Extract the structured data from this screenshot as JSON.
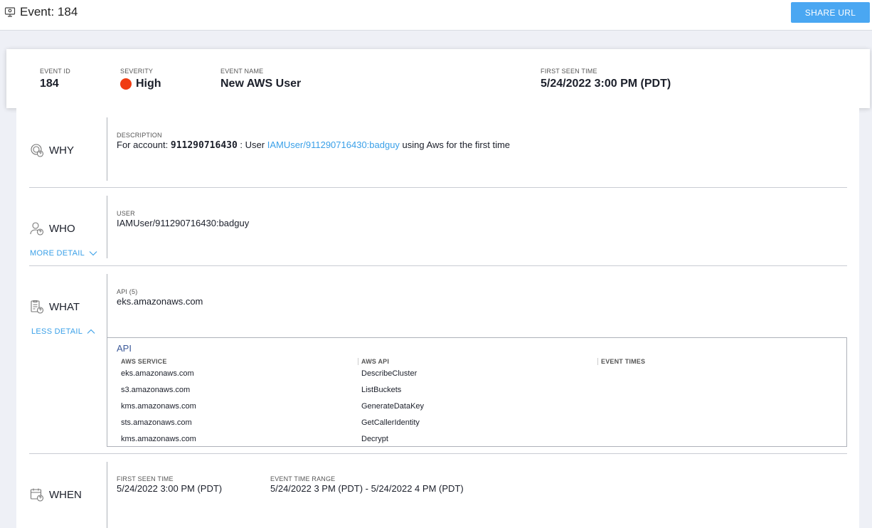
{
  "header": {
    "title": "Event: 184",
    "share_label": "SHARE URL"
  },
  "summary": {
    "event_id_label": "EVENT ID",
    "event_id": "184",
    "severity_label": "SEVERITY",
    "severity": "High",
    "severity_color": "#f03c12",
    "event_name_label": "EVENT NAME",
    "event_name": "New AWS User",
    "first_seen_label": "FIRST SEEN TIME",
    "first_seen": "5/24/2022 3:00 PM (PDT)"
  },
  "why": {
    "heading": "WHY",
    "description_label": "DESCRIPTION",
    "desc_prefix": "For account: ",
    "desc_account": "911290716430",
    "desc_mid": " : User ",
    "desc_user_link": "IAMUser/911290716430:badguy",
    "desc_suffix": " using Aws for the first time"
  },
  "who": {
    "heading": "WHO",
    "more_detail": "MORE DETAIL",
    "user_label": "USER",
    "user": "IAMUser/911290716430:badguy"
  },
  "what": {
    "heading": "WHAT",
    "less_detail": "LESS DETAIL",
    "api_label": "API (5)",
    "api_value": "eks.amazonaws.com",
    "table_title": "API",
    "columns": [
      "AWS SERVICE",
      "AWS API",
      "EVENT TIMES"
    ],
    "rows": [
      {
        "service": "eks.amazonaws.com",
        "api": "DescribeCluster"
      },
      {
        "service": "s3.amazonaws.com",
        "api": "ListBuckets"
      },
      {
        "service": "kms.amazonaws.com",
        "api": "GenerateDataKey"
      },
      {
        "service": "sts.amazonaws.com",
        "api": "GetCallerIdentity"
      },
      {
        "service": "kms.amazonaws.com",
        "api": "Decrypt"
      }
    ]
  },
  "when": {
    "heading": "WHEN",
    "first_seen_label": "FIRST SEEN TIME",
    "first_seen": "5/24/2022 3:00 PM (PDT)",
    "range_label": "EVENT TIME RANGE",
    "range": "5/24/2022 3 PM (PDT) - 5/24/2022 4 PM (PDT)"
  }
}
